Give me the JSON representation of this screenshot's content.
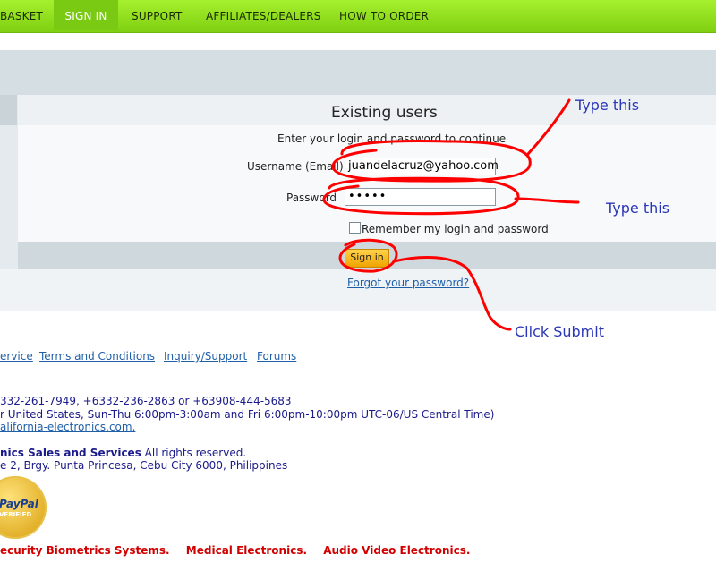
{
  "nav": {
    "items": [
      {
        "label": "BASKET"
      },
      {
        "label": "SIGN IN"
      },
      {
        "label": "SUPPORT"
      },
      {
        "label": "AFFILIATES/DEALERS"
      },
      {
        "label": "HOW TO ORDER"
      }
    ],
    "active": "SIGN IN"
  },
  "login": {
    "title": "Existing users",
    "subtitle": "Enter your login and password to continue",
    "username_label": "Username (Email)",
    "username_value": "juandelacruz@yahoo.com",
    "password_label": "Password",
    "password_value": "•••••",
    "remember_label": "Remember my login and password",
    "remember_checked": false,
    "signin_label": "Sign in",
    "forgot_label": "Forgot your password?"
  },
  "annotations": {
    "username_note": "Type this",
    "password_note": "Type this",
    "submit_note": "Click Submit",
    "color": "#2a36b8",
    "marker_color": "#ff0000"
  },
  "footer": {
    "links": [
      "ervice",
      "Terms and Conditions",
      "Inquiry/Support",
      "Forums"
    ],
    "phone": "332-261-7949, +6332-236-2863 or +63908-444-5683",
    "hours": "r United States, Sun-Thu 6:00pm-3:00am and Fri 6:00pm-10:00pm UTC-06/US Central Time)",
    "email": "alifornia-electronics.com.",
    "company_name": "nics Sales and Services",
    "rights": " All rights reserved.",
    "address": "e 2, Brgy. Punta Princesa, Cebu City 6000, Philippines",
    "paypal": {
      "name": "PayPal",
      "status": "VERIFIED"
    },
    "brands": [
      "ecurity Biometrics Systems.",
      "Medical Electronics.",
      "Audio Video Electronics."
    ]
  },
  "colors": {
    "nav_green": "#8fdc1e",
    "nav_active": "#7ac913",
    "link_blue": "#1f5fa8",
    "brand_red": "#d10000",
    "button_orange": "#f5b400"
  }
}
